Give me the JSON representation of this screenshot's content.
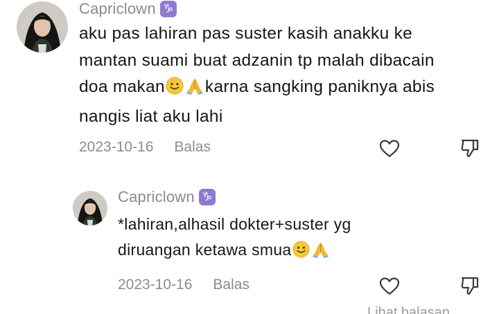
{
  "comment": {
    "username": "Capriclown",
    "zodiac_glyph": "♑",
    "text_lines": [
      "aku pas lahiran pas suster kasih anakku ke",
      "mantan suami buat adzanin tp malah dibacain",
      "doa makan",
      "karna sangking paniknya abis",
      "nangis liat aku lahi"
    ],
    "date": "2023-10-16",
    "reply_label": "Balas"
  },
  "reply": {
    "username": "Capriclown",
    "zodiac_glyph": "♑",
    "text_lines": [
      "*lahiran,alhasil dokter+suster yg",
      "diruangan ketawa smua"
    ],
    "date": "2023-10-16",
    "reply_label": "Balas"
  },
  "footer": {
    "view_more": "Lihat balasan"
  },
  "icons": {
    "like": "heart-outline-icon",
    "dislike": "thumbs-down-outline-icon",
    "zodiac": "capricorn-icon"
  },
  "colors": {
    "zodiac_badge": "#8e7bd1",
    "secondary_text": "#8a8a8a"
  }
}
